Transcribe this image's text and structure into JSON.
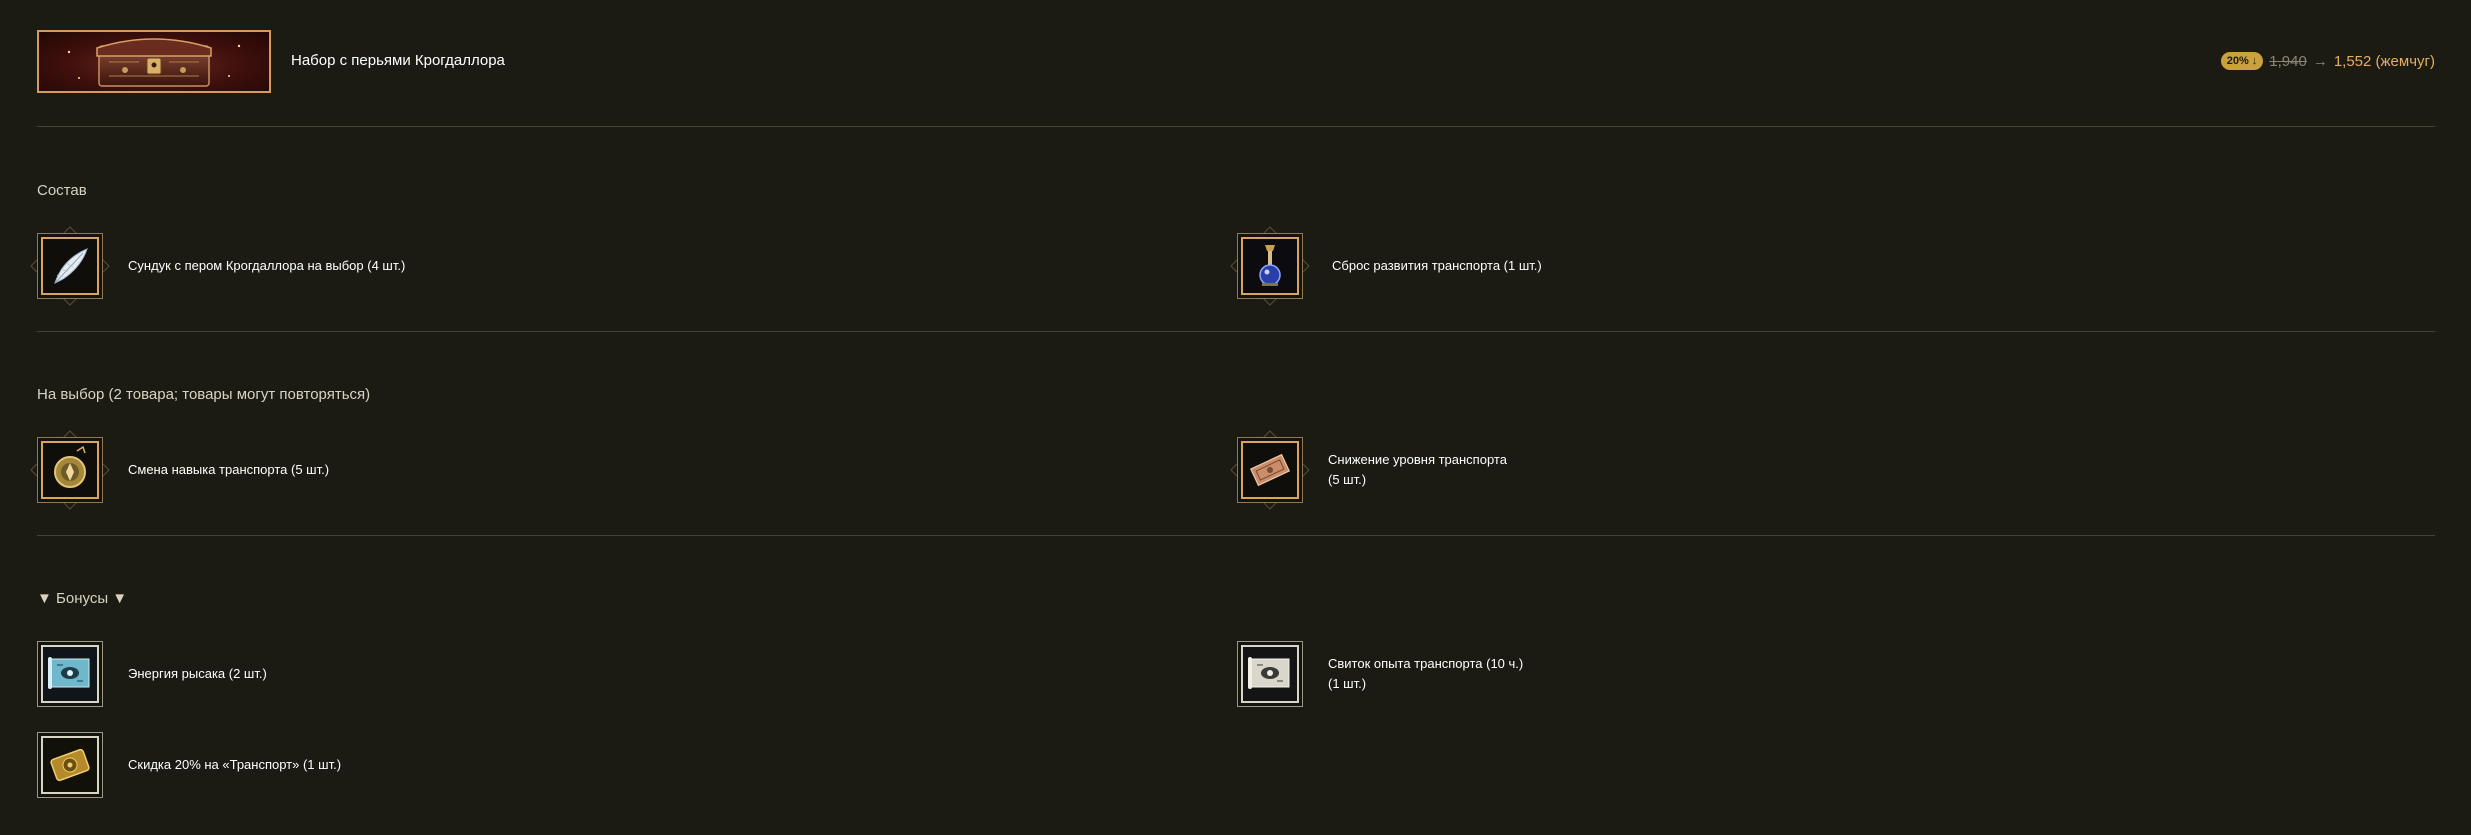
{
  "header": {
    "title": "Набор с перьями Крогдаллора",
    "discount_badge": "20% ↓",
    "old_price": "1,940",
    "arrow": "→",
    "new_price": "1,552 (жемчуг)"
  },
  "sections": {
    "contents": {
      "title": "Состав",
      "items": [
        {
          "label": "Сундук с пером Крогдаллора на выбор (4 шт.)",
          "icon": "feather-icon"
        },
        {
          "label": "Сброс развития транспорта (1 шт.)",
          "icon": "potion-bottle-icon"
        }
      ]
    },
    "choice": {
      "title": "На выбор (2 товара; товары могут повторяться)",
      "items": [
        {
          "label": "Смена навыка транспорта (5 шт.)",
          "icon": "compass-icon"
        },
        {
          "label_line1": "Снижение уровня транспорта",
          "label_line2": "(5 шт.)",
          "icon": "ticket-icon"
        }
      ]
    },
    "bonuses": {
      "title": "▼ Бонусы ▼",
      "items": [
        {
          "label": "Энергия рысака (2 шт.)",
          "icon": "scroll-icon"
        },
        {
          "label_line1": "Свиток опыта транспорта (10 ч.)",
          "label_line2": "(1 шт.)",
          "icon": "scroll-icon"
        },
        {
          "label": "Скидка 20% на «Транспорт» (1 шт.)",
          "icon": "coupon-icon"
        }
      ]
    }
  },
  "colors": {
    "background": "#1b1a13",
    "accent_gold": "#e4ae63",
    "badge": "#c9a13d",
    "divider": "#45432f"
  }
}
